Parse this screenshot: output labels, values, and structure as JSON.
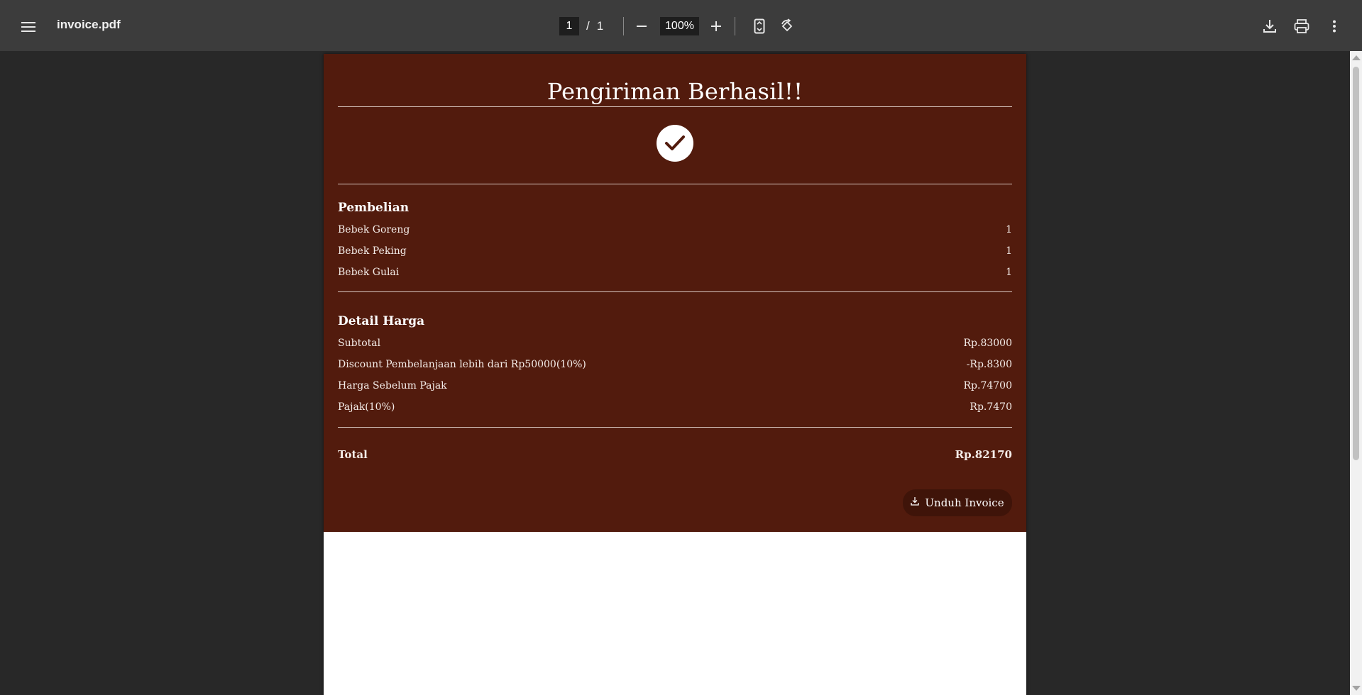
{
  "toolbar": {
    "title": "invoice.pdf",
    "current_page": "1",
    "page_separator": "/",
    "total_pages": "1",
    "zoom": "100%",
    "icons": {
      "menu": "menu-icon",
      "zoom_out": "minus-icon",
      "zoom_in": "plus-icon",
      "fit_page": "fit-page-icon",
      "rotate": "rotate-icon",
      "download": "download-icon",
      "print": "print-icon",
      "more": "more-vert-icon"
    }
  },
  "invoice": {
    "title": "Pengiriman Berhasil!!",
    "background_color": "#521b0d",
    "purchase": {
      "heading": "Pembelian",
      "items": [
        {
          "name": "Bebek Goreng",
          "qty": "1"
        },
        {
          "name": "Bebek Peking",
          "qty": "1"
        },
        {
          "name": "Bebek Gulai",
          "qty": "1"
        }
      ]
    },
    "price_detail": {
      "heading": "Detail Harga",
      "rows": [
        {
          "label": "Subtotal",
          "value": "Rp.83000"
        },
        {
          "label": "Discount Pembelanjaan lebih dari Rp50000(10%)",
          "value": "-Rp.8300"
        },
        {
          "label": "Harga Sebelum Pajak",
          "value": "Rp.74700"
        },
        {
          "label": "Pajak(10%)",
          "value": "Rp.7470"
        }
      ]
    },
    "total": {
      "label": "Total",
      "value": "Rp.82170"
    },
    "download_button": "Unduh Invoice"
  }
}
